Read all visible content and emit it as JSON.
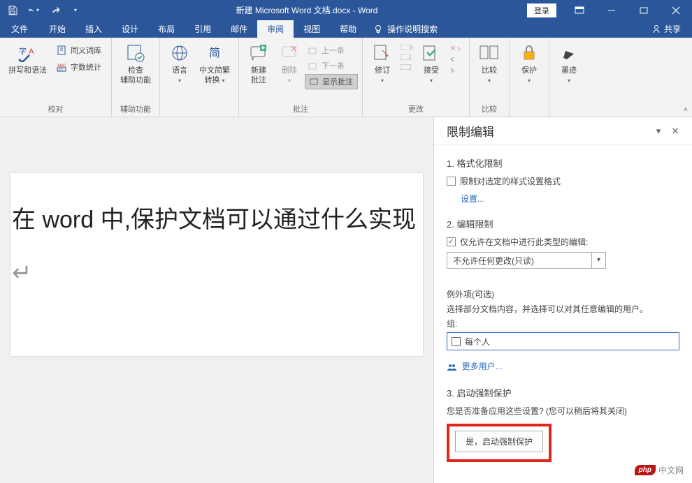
{
  "title": "新建 Microsoft Word 文档.docx - Word",
  "login": "登录",
  "tabs": {
    "file": "文件",
    "home": "开始",
    "insert": "插入",
    "design": "设计",
    "layout": "布局",
    "references": "引用",
    "mailings": "邮件",
    "review": "审阅",
    "view": "视图",
    "help": "帮助",
    "tellme": "操作说明搜索",
    "share": "共享"
  },
  "ribbon": {
    "proofing": {
      "spelling": "拼写和语法",
      "thesaurus": "同义词库",
      "wordcount": "字数统计",
      "group": "校对"
    },
    "accessibility": {
      "check": "检查\n辅助功能",
      "group": "辅助功能"
    },
    "language": {
      "language": "语言",
      "translate": "中文简繁\n转换",
      "group": ""
    },
    "comments": {
      "new": "新建\n批注",
      "delete": "删除",
      "prev": "上一条",
      "next": "下一条",
      "show": "显示批注",
      "group": "批注"
    },
    "tracking": {
      "track": "修订",
      "accept": "接受",
      "group": "更改"
    },
    "compare": {
      "compare": "比较",
      "group": "比较"
    },
    "protect": {
      "protect": "保护"
    },
    "ink": {
      "ink": "墨迹"
    }
  },
  "doc_text": "在 word 中,保护文档可以通过什么实现",
  "pane": {
    "title": "限制编辑",
    "s1": "1. 格式化限制",
    "s1_chk": "限制对选定的样式设置格式",
    "settings": "设置...",
    "s2": "2. 编辑限制",
    "s2_chk": "仅允许在文档中进行此类型的编辑:",
    "select_val": "不允许任何更改(只读)",
    "exceptions": "例外项(可选)",
    "exceptions_desc": "选择部分文档内容，并选择可以对其任意编辑的用户。",
    "groups": "组:",
    "everyone": "每个人",
    "more_users": "更多用户...",
    "s3": "3. 启动强制保护",
    "s3_desc": "您是否准备应用这些设置? (您可以稍后将其关闭)",
    "enforce_btn": "是，启动强制保护"
  },
  "watermark": "中文网"
}
